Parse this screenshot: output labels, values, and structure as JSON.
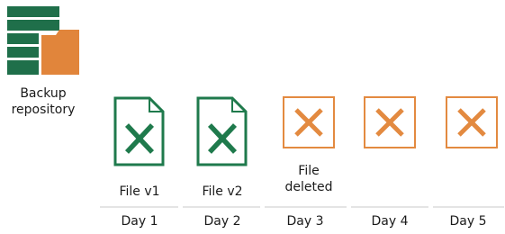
{
  "repository": {
    "label_line1": "Backup",
    "label_line2": "repository",
    "colors": {
      "stack": "#1f6f4a",
      "folder": "#e1853b"
    }
  },
  "items": [
    {
      "icon": "file-check-icon",
      "label": "File v1",
      "day": "Day 1"
    },
    {
      "icon": "file-check-icon",
      "label": "File v2",
      "day": "Day 2"
    },
    {
      "icon": "cross-icon",
      "label_line1": "File",
      "label_line2": "deleted",
      "day": "Day 3"
    },
    {
      "icon": "cross-icon",
      "day": "Day 4"
    },
    {
      "icon": "cross-icon",
      "day": "Day 5"
    }
  ],
  "colors": {
    "file_green": "#1f7a4c",
    "cross_orange": "#e38a40",
    "timeline": "#e4e4e4"
  }
}
